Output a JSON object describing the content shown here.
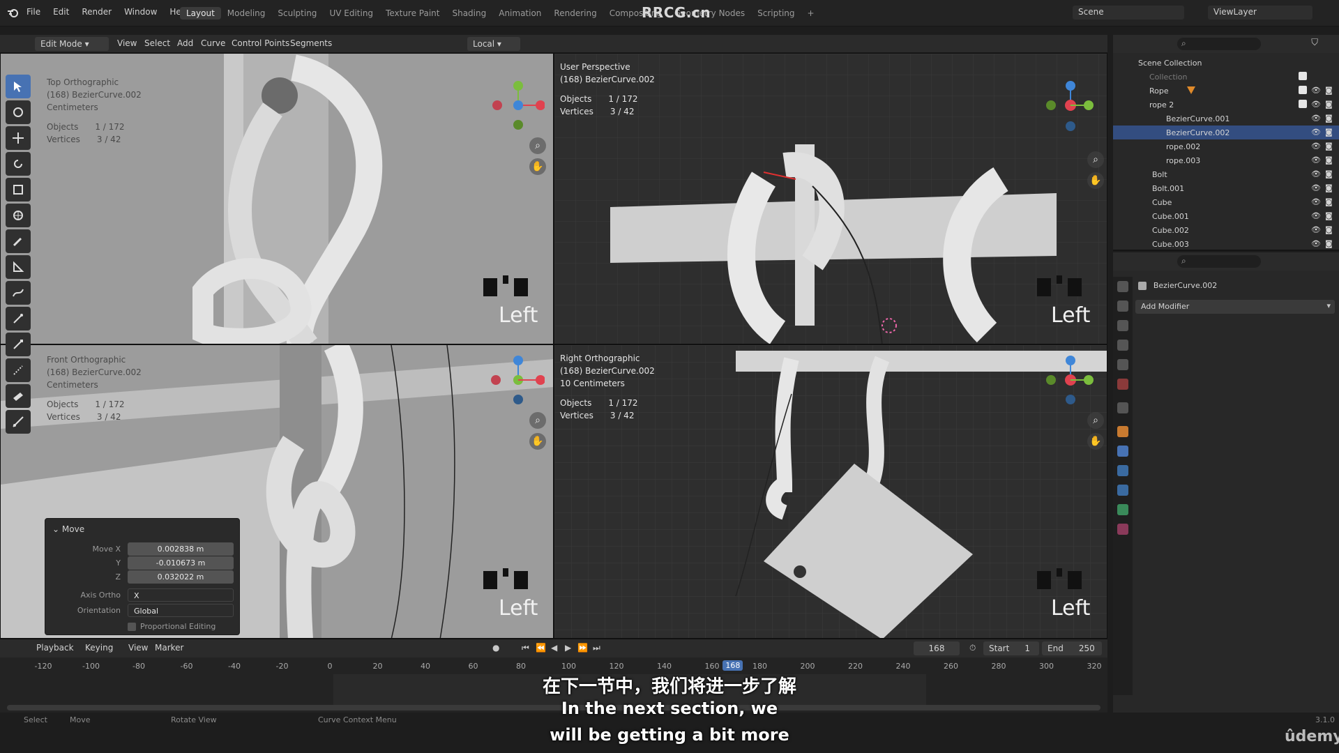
{
  "brand_top": "RRCG.cn",
  "menu": [
    "File",
    "Edit",
    "Render",
    "Window",
    "Help"
  ],
  "workspace_tabs": [
    "Layout",
    "Modeling",
    "Sculpting",
    "UV Editing",
    "Texture Paint",
    "Shading",
    "Animation",
    "Rendering",
    "Compositing",
    "Geometry Nodes",
    "Scripting",
    "+"
  ],
  "active_tab": "Layout",
  "scene_label": "Scene",
  "viewlayer_label": "ViewLayer",
  "header": {
    "mode": "Edit Mode",
    "menus": [
      "View",
      "Select",
      "Add",
      "Curve",
      "Control Points",
      "Segments"
    ],
    "pivot": "Local"
  },
  "viewports": {
    "top_left": {
      "view": "Top Orthographic",
      "object": "(168) BezierCurve.002",
      "units": "Centimeters",
      "objects_label": "Objects",
      "objects": "1 / 172",
      "vertices_label": "Vertices",
      "vertices": "3 / 42",
      "overlay": "Left"
    },
    "top_right": {
      "view": "User Perspective",
      "object": "(168) BezierCurve.002",
      "objects_label": "Objects",
      "objects": "1 / 172",
      "vertices_label": "Vertices",
      "vertices": "3 / 42",
      "overlay": "Left"
    },
    "bottom_left": {
      "view": "Front Orthographic",
      "object": "(168) BezierCurve.002",
      "units": "Centimeters",
      "objects_label": "Objects",
      "objects": "1 / 172",
      "vertices_label": "Vertices",
      "vertices": "3 / 42",
      "overlay": "Left"
    },
    "bottom_right": {
      "view": "Right Orthographic",
      "object": "(168) BezierCurve.002",
      "units": "10 Centimeters",
      "objects_label": "Objects",
      "objects": "1 / 172",
      "vertices_label": "Vertices",
      "vertices": "3 / 42",
      "overlay": "Left"
    }
  },
  "move_panel": {
    "title": "Move",
    "move_x_label": "Move X",
    "move_x": "0.002838 m",
    "y_label": "Y",
    "y": "-0.010673 m",
    "z_label": "Z",
    "z": "0.032022 m",
    "axis_ortho_label": "Axis Ortho",
    "axis_ortho": "X",
    "orientation_label": "Orientation",
    "orientation": "Global",
    "proportional": "Proportional Editing"
  },
  "outliner": {
    "root": "Scene Collection",
    "items": [
      {
        "name": "Collection",
        "dim": true
      },
      {
        "name": "Rope"
      },
      {
        "name": "rope 2"
      },
      {
        "name": "BezierCurve.001"
      },
      {
        "name": "BezierCurve.002",
        "selected": true
      },
      {
        "name": "rope.002"
      },
      {
        "name": "rope.003"
      },
      {
        "name": "Bolt"
      },
      {
        "name": "Bolt.001"
      },
      {
        "name": "Cube"
      },
      {
        "name": "Cube.001"
      },
      {
        "name": "Cube.002"
      },
      {
        "name": "Cube.003"
      }
    ]
  },
  "properties": {
    "object": "BezierCurve.002",
    "add_modifier": "Add Modifier"
  },
  "timeline": {
    "menus": [
      "Playback",
      "Keying",
      "View",
      "Marker"
    ],
    "current_frame": "168",
    "start_label": "Start",
    "start": "1",
    "end_label": "End",
    "end": "250",
    "ticks": [
      "-120",
      "-100",
      "-80",
      "-60",
      "-40",
      "-20",
      "0",
      "20",
      "40",
      "60",
      "80",
      "100",
      "120",
      "140",
      "160",
      "168",
      "180",
      "200",
      "220",
      "240",
      "260",
      "280",
      "300",
      "320"
    ]
  },
  "statusbar": {
    "select": "Select",
    "move": "Move",
    "rotate": "Rotate View",
    "context": "Curve Context Menu",
    "version": "3.1.0",
    "udemy": "ûdemy"
  },
  "subtitles": {
    "chinese": "在下一节中，我们将进一步了解",
    "english1": "In the next section, we",
    "english2": "will be getting a bit more"
  },
  "colors": {
    "accent": "#4772b3",
    "selected_row": "#334d80",
    "viewport_light": "#9c9c9c",
    "viewport_dark": "#2e2e2e"
  }
}
